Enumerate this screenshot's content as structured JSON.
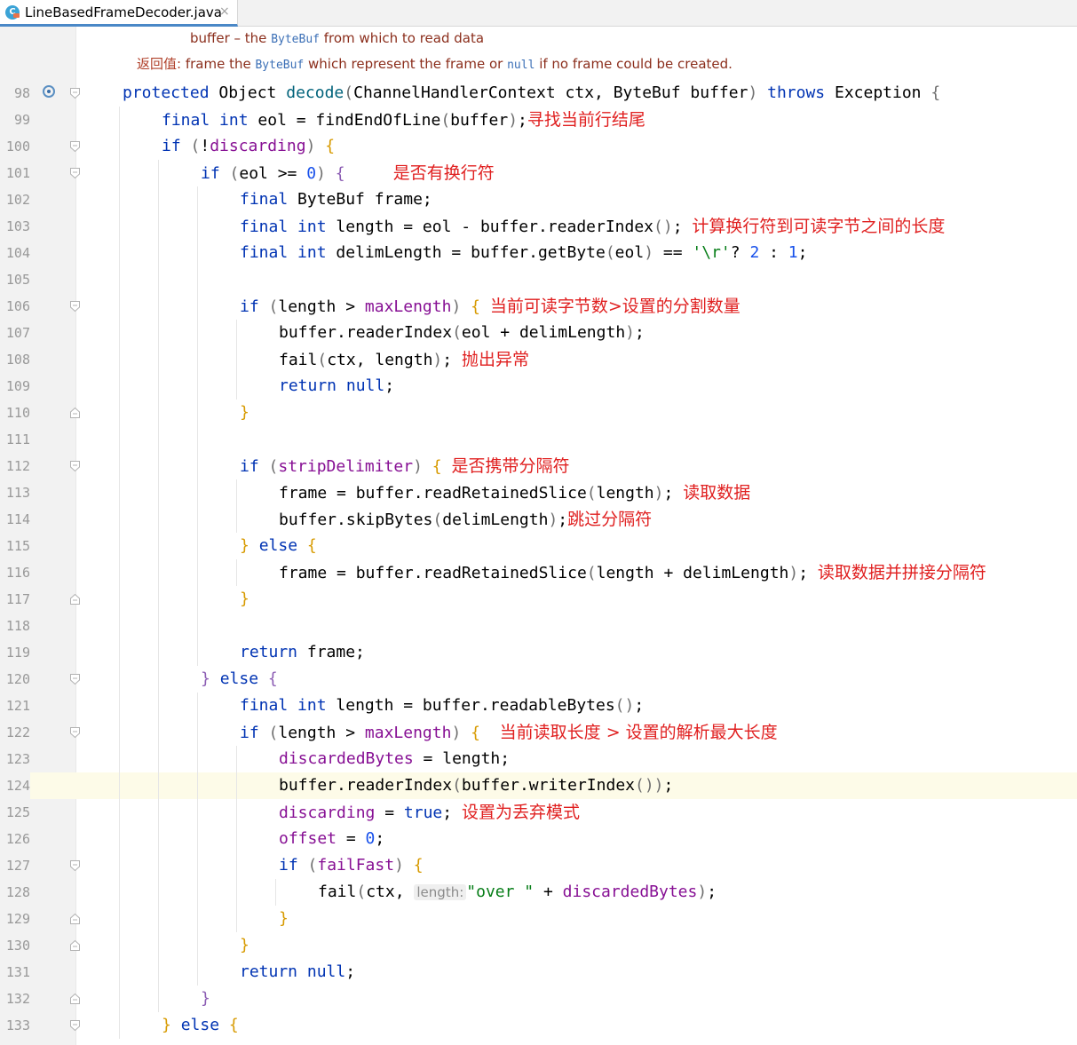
{
  "tab": {
    "title": "LineBasedFrameDecoder.java",
    "icon_letter": "C",
    "close": "×"
  },
  "doc": {
    "line1": {
      "a": "buffer – the ",
      "b": "ByteBuf",
      "c": " from which to read data"
    },
    "line2": {
      "label": "返回值:",
      "a": " frame the ",
      "b": "ByteBuf",
      "c": " which represent the frame or ",
      "d": "null",
      "e": " if no frame could be created."
    }
  },
  "code": [
    {
      "n": "98",
      "indent": 0,
      "gutter_icon": "overrides-icon",
      "fold": "down",
      "tokens": [
        {
          "t": "protected ",
          "c": "kw"
        },
        {
          "t": "Object "
        },
        {
          "t": "decode",
          "c": "fn"
        },
        {
          "t": "(",
          "c": "pa"
        },
        {
          "t": "ChannelHandlerContext ctx, ByteBuf buffer"
        },
        {
          "t": ")",
          "c": "pa"
        },
        {
          "t": " "
        },
        {
          "t": "throws ",
          "c": "kw"
        },
        {
          "t": "Exception "
        },
        {
          "t": "{",
          "c": "pa"
        }
      ]
    },
    {
      "n": "99",
      "indent": 1,
      "tokens": [
        {
          "t": "final ",
          "c": "kw"
        },
        {
          "t": "int ",
          "c": "kw"
        },
        {
          "t": "eol = "
        },
        {
          "t": "findEndOfLine"
        },
        {
          "t": "(",
          "c": "pa"
        },
        {
          "t": "buffer"
        },
        {
          "t": ")",
          "c": "pa"
        },
        {
          "t": ";"
        }
      ],
      "note": "寻找当前行结尾"
    },
    {
      "n": "100",
      "indent": 1,
      "fold": "down",
      "tokens": [
        {
          "t": "if ",
          "c": "kw"
        },
        {
          "t": "(",
          "c": "pa"
        },
        {
          "t": "!"
        },
        {
          "t": "discarding",
          "c": "fld"
        },
        {
          "t": ")",
          "c": "pa"
        },
        {
          "t": " "
        },
        {
          "t": "{",
          "c": "pb"
        }
      ]
    },
    {
      "n": "101",
      "indent": 2,
      "fold": "down",
      "tokens": [
        {
          "t": "if ",
          "c": "kw"
        },
        {
          "t": "(",
          "c": "pa"
        },
        {
          "t": "eol >= "
        },
        {
          "t": "0",
          "c": "num"
        },
        {
          "t": ")",
          "c": "pa"
        },
        {
          "t": " "
        },
        {
          "t": "{",
          "c": "pc"
        },
        {
          "t": "     "
        }
      ],
      "note": "是否有换行符"
    },
    {
      "n": "102",
      "indent": 3,
      "tokens": [
        {
          "t": "final ",
          "c": "kw"
        },
        {
          "t": "ByteBuf frame;"
        }
      ]
    },
    {
      "n": "103",
      "indent": 3,
      "tokens": [
        {
          "t": "final ",
          "c": "kw"
        },
        {
          "t": "int ",
          "c": "kw"
        },
        {
          "t": "length = eol - buffer.readerIndex"
        },
        {
          "t": "()",
          "c": "pa"
        },
        {
          "t": "; "
        }
      ],
      "note": "计算换行符到可读字节之间的长度"
    },
    {
      "n": "104",
      "indent": 3,
      "tokens": [
        {
          "t": "final ",
          "c": "kw"
        },
        {
          "t": "int ",
          "c": "kw"
        },
        {
          "t": "delimLength = buffer.getByte"
        },
        {
          "t": "(",
          "c": "pa"
        },
        {
          "t": "eol"
        },
        {
          "t": ")",
          "c": "pa"
        },
        {
          "t": " == "
        },
        {
          "t": "'\\r'",
          "c": "str"
        },
        {
          "t": "? "
        },
        {
          "t": "2",
          "c": "num"
        },
        {
          "t": " : "
        },
        {
          "t": "1",
          "c": "num"
        },
        {
          "t": ";"
        }
      ]
    },
    {
      "n": "105",
      "indent": 3,
      "tokens": []
    },
    {
      "n": "106",
      "indent": 3,
      "fold": "down",
      "tokens": [
        {
          "t": "if ",
          "c": "kw"
        },
        {
          "t": "(",
          "c": "pa"
        },
        {
          "t": "length > "
        },
        {
          "t": "maxLength",
          "c": "fld"
        },
        {
          "t": ")",
          "c": "pa"
        },
        {
          "t": " "
        },
        {
          "t": "{",
          "c": "pb"
        },
        {
          "t": " "
        }
      ],
      "note": "当前可读字节数>设置的分割数量"
    },
    {
      "n": "107",
      "indent": 4,
      "tokens": [
        {
          "t": "buffer.readerIndex"
        },
        {
          "t": "(",
          "c": "pa"
        },
        {
          "t": "eol + delimLength"
        },
        {
          "t": ")",
          "c": "pa"
        },
        {
          "t": ";"
        }
      ]
    },
    {
      "n": "108",
      "indent": 4,
      "tokens": [
        {
          "t": "fail"
        },
        {
          "t": "(",
          "c": "pa"
        },
        {
          "t": "ctx, length"
        },
        {
          "t": ")",
          "c": "pa"
        },
        {
          "t": "; "
        }
      ],
      "note": "抛出异常"
    },
    {
      "n": "109",
      "indent": 4,
      "tokens": [
        {
          "t": "return ",
          "c": "kw"
        },
        {
          "t": "null",
          "c": "kw"
        },
        {
          "t": ";"
        }
      ]
    },
    {
      "n": "110",
      "indent": 3,
      "fold": "up",
      "tokens": [
        {
          "t": "}",
          "c": "pb"
        }
      ]
    },
    {
      "n": "111",
      "indent": 3,
      "tokens": []
    },
    {
      "n": "112",
      "indent": 3,
      "fold": "down",
      "tokens": [
        {
          "t": "if ",
          "c": "kw"
        },
        {
          "t": "(",
          "c": "pa"
        },
        {
          "t": "stripDelimiter",
          "c": "fld"
        },
        {
          "t": ")",
          "c": "pa"
        },
        {
          "t": " "
        },
        {
          "t": "{",
          "c": "pb"
        },
        {
          "t": " "
        }
      ],
      "note": "是否携带分隔符"
    },
    {
      "n": "113",
      "indent": 4,
      "tokens": [
        {
          "t": "frame = buffer.readRetainedSlice"
        },
        {
          "t": "(",
          "c": "pa"
        },
        {
          "t": "length"
        },
        {
          "t": ")",
          "c": "pa"
        },
        {
          "t": "; "
        }
      ],
      "note": "读取数据"
    },
    {
      "n": "114",
      "indent": 4,
      "tokens": [
        {
          "t": "buffer.skipBytes"
        },
        {
          "t": "(",
          "c": "pa"
        },
        {
          "t": "delimLength"
        },
        {
          "t": ")",
          "c": "pa"
        },
        {
          "t": ";"
        }
      ],
      "note": "跳过分隔符"
    },
    {
      "n": "115",
      "indent": 3,
      "tokens": [
        {
          "t": "} ",
          "c": "pb"
        },
        {
          "t": "else ",
          "c": "kw"
        },
        {
          "t": "{",
          "c": "pb"
        }
      ]
    },
    {
      "n": "116",
      "indent": 4,
      "tokens": [
        {
          "t": "frame = buffer.readRetainedSlice"
        },
        {
          "t": "(",
          "c": "pa"
        },
        {
          "t": "length + delimLength"
        },
        {
          "t": ")",
          "c": "pa"
        },
        {
          "t": "; "
        }
      ],
      "note": "读取数据并拼接分隔符"
    },
    {
      "n": "117",
      "indent": 3,
      "fold": "up",
      "tokens": [
        {
          "t": "}",
          "c": "pb"
        }
      ]
    },
    {
      "n": "118",
      "indent": 3,
      "tokens": []
    },
    {
      "n": "119",
      "indent": 3,
      "tokens": [
        {
          "t": "return ",
          "c": "kw"
        },
        {
          "t": "frame;"
        }
      ]
    },
    {
      "n": "120",
      "indent": 2,
      "fold": "down",
      "tokens": [
        {
          "t": "} ",
          "c": "pc"
        },
        {
          "t": "else ",
          "c": "kw"
        },
        {
          "t": "{",
          "c": "pc"
        }
      ]
    },
    {
      "n": "121",
      "indent": 3,
      "tokens": [
        {
          "t": "final ",
          "c": "kw"
        },
        {
          "t": "int ",
          "c": "kw"
        },
        {
          "t": "length = buffer.readableBytes"
        },
        {
          "t": "()",
          "c": "pa"
        },
        {
          "t": ";"
        }
      ]
    },
    {
      "n": "122",
      "indent": 3,
      "fold": "down",
      "tokens": [
        {
          "t": "if ",
          "c": "kw"
        },
        {
          "t": "(",
          "c": "pa"
        },
        {
          "t": "length > "
        },
        {
          "t": "maxLength",
          "c": "fld"
        },
        {
          "t": ")",
          "c": "pa"
        },
        {
          "t": " "
        },
        {
          "t": "{",
          "c": "pb"
        },
        {
          "t": "  "
        }
      ],
      "note": "当前读取长度 > 设置的解析最大长度"
    },
    {
      "n": "123",
      "indent": 4,
      "tokens": [
        {
          "t": "discardedBytes",
          "c": "fld"
        },
        {
          "t": " = length;"
        }
      ]
    },
    {
      "n": "124",
      "indent": 4,
      "current": true,
      "tokens": [
        {
          "t": "buffer.readerIndex"
        },
        {
          "t": "(",
          "c": "pa"
        },
        {
          "t": "buffer.writerIndex"
        },
        {
          "t": "())",
          "c": "pa"
        },
        {
          "t": ";"
        }
      ]
    },
    {
      "n": "125",
      "indent": 4,
      "tokens": [
        {
          "t": "discarding",
          "c": "fld"
        },
        {
          "t": " = "
        },
        {
          "t": "true",
          "c": "kw"
        },
        {
          "t": "; "
        }
      ],
      "note": "设置为丢弃模式"
    },
    {
      "n": "126",
      "indent": 4,
      "tokens": [
        {
          "t": "offset",
          "c": "fld"
        },
        {
          "t": " = "
        },
        {
          "t": "0",
          "c": "num"
        },
        {
          "t": ";"
        }
      ]
    },
    {
      "n": "127",
      "indent": 4,
      "fold": "down",
      "tokens": [
        {
          "t": "if ",
          "c": "kw"
        },
        {
          "t": "(",
          "c": "pa"
        },
        {
          "t": "failFast",
          "c": "fld"
        },
        {
          "t": ")",
          "c": "pa"
        },
        {
          "t": " "
        },
        {
          "t": "{",
          "c": "pb"
        }
      ]
    },
    {
      "n": "128",
      "indent": 5,
      "tokens": [
        {
          "t": "fail"
        },
        {
          "t": "(",
          "c": "pa"
        },
        {
          "t": "ctx, "
        },
        {
          "t": "length:",
          "c": "hint"
        },
        {
          "t": "\"over \"",
          "c": "str"
        },
        {
          "t": " + "
        },
        {
          "t": "discardedBytes",
          "c": "fld"
        },
        {
          "t": ")",
          "c": "pa"
        },
        {
          "t": ";"
        }
      ]
    },
    {
      "n": "129",
      "indent": 4,
      "fold": "up",
      "tokens": [
        {
          "t": "}",
          "c": "pb"
        }
      ]
    },
    {
      "n": "130",
      "indent": 3,
      "fold": "up",
      "tokens": [
        {
          "t": "}",
          "c": "pb"
        }
      ]
    },
    {
      "n": "131",
      "indent": 3,
      "tokens": [
        {
          "t": "return ",
          "c": "kw"
        },
        {
          "t": "null",
          "c": "kw"
        },
        {
          "t": ";"
        }
      ]
    },
    {
      "n": "132",
      "indent": 2,
      "fold": "up",
      "tokens": [
        {
          "t": "}",
          "c": "pc"
        }
      ]
    },
    {
      "n": "133",
      "indent": 1,
      "fold": "down",
      "tokens": [
        {
          "t": "} ",
          "c": "pb"
        },
        {
          "t": "else ",
          "c": "kw"
        },
        {
          "t": "{",
          "c": "pb"
        }
      ]
    }
  ]
}
